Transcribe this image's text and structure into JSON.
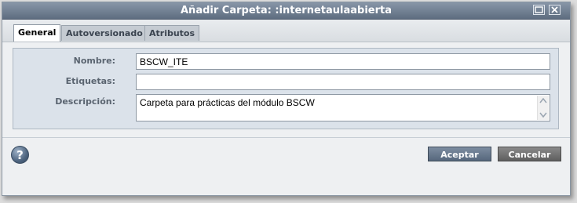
{
  "dialog": {
    "title": "Añadir Carpeta: :internetaulaabierta",
    "controls": [
      "maximize-icon",
      "close-icon"
    ]
  },
  "tabs": [
    {
      "label": "General",
      "active": true
    },
    {
      "label": "Autoversionado",
      "active": false
    },
    {
      "label": "Atributos",
      "active": false
    }
  ],
  "form": {
    "name_label": "Nombre:",
    "name_value": "BSCW_ITE",
    "tags_label": "Etiquetas:",
    "tags_value": "",
    "description_label": "Descripción:",
    "description_value": "Carpeta para prácticas del módulo BSCW"
  },
  "footer": {
    "help_glyph": "?",
    "accept_label": "Aceptar",
    "cancel_label": "Cancelar"
  },
  "colors": {
    "titlebar": "#6f7e91",
    "panel": "#dbe2ea",
    "accept": "#5f7085",
    "cancel": "#6e6e6e"
  }
}
